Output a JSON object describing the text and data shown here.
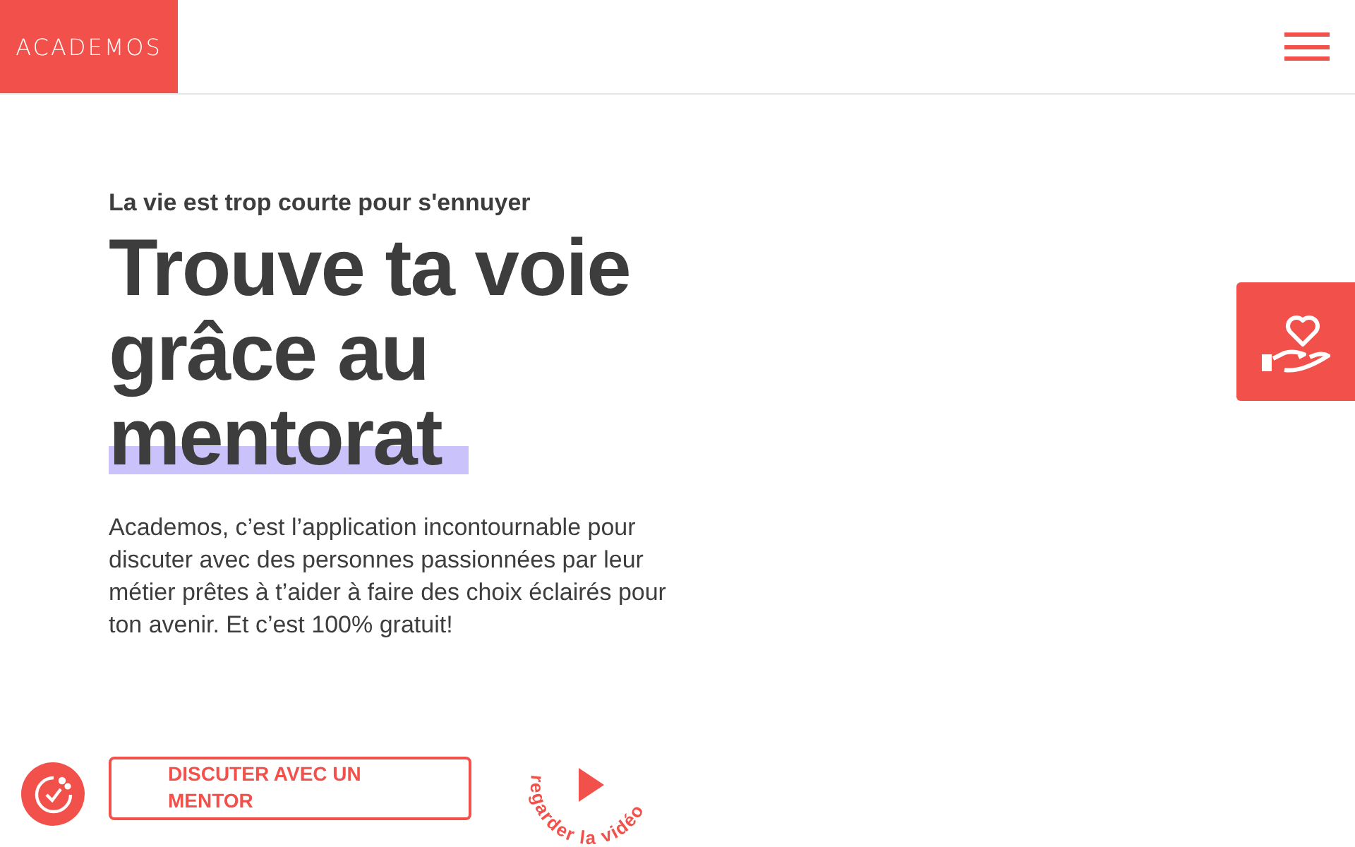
{
  "header": {
    "logo": "ACADEMOS"
  },
  "hero": {
    "eyebrow": "La vie est trop courte pour s'ennuyer",
    "headline": "Trouve ta voie grâce au mentorat",
    "description": "Academos, c’est l’application incontournable pour discuter avec des personnes passionnées par leur métier prêtes à t’aider à faire des choix éclairés pour ton avenir. Et c’est 100% gratuit!",
    "cta": "DISCUTER AVEC UN MENTOR",
    "video_link": "regarder la vidéo"
  }
}
